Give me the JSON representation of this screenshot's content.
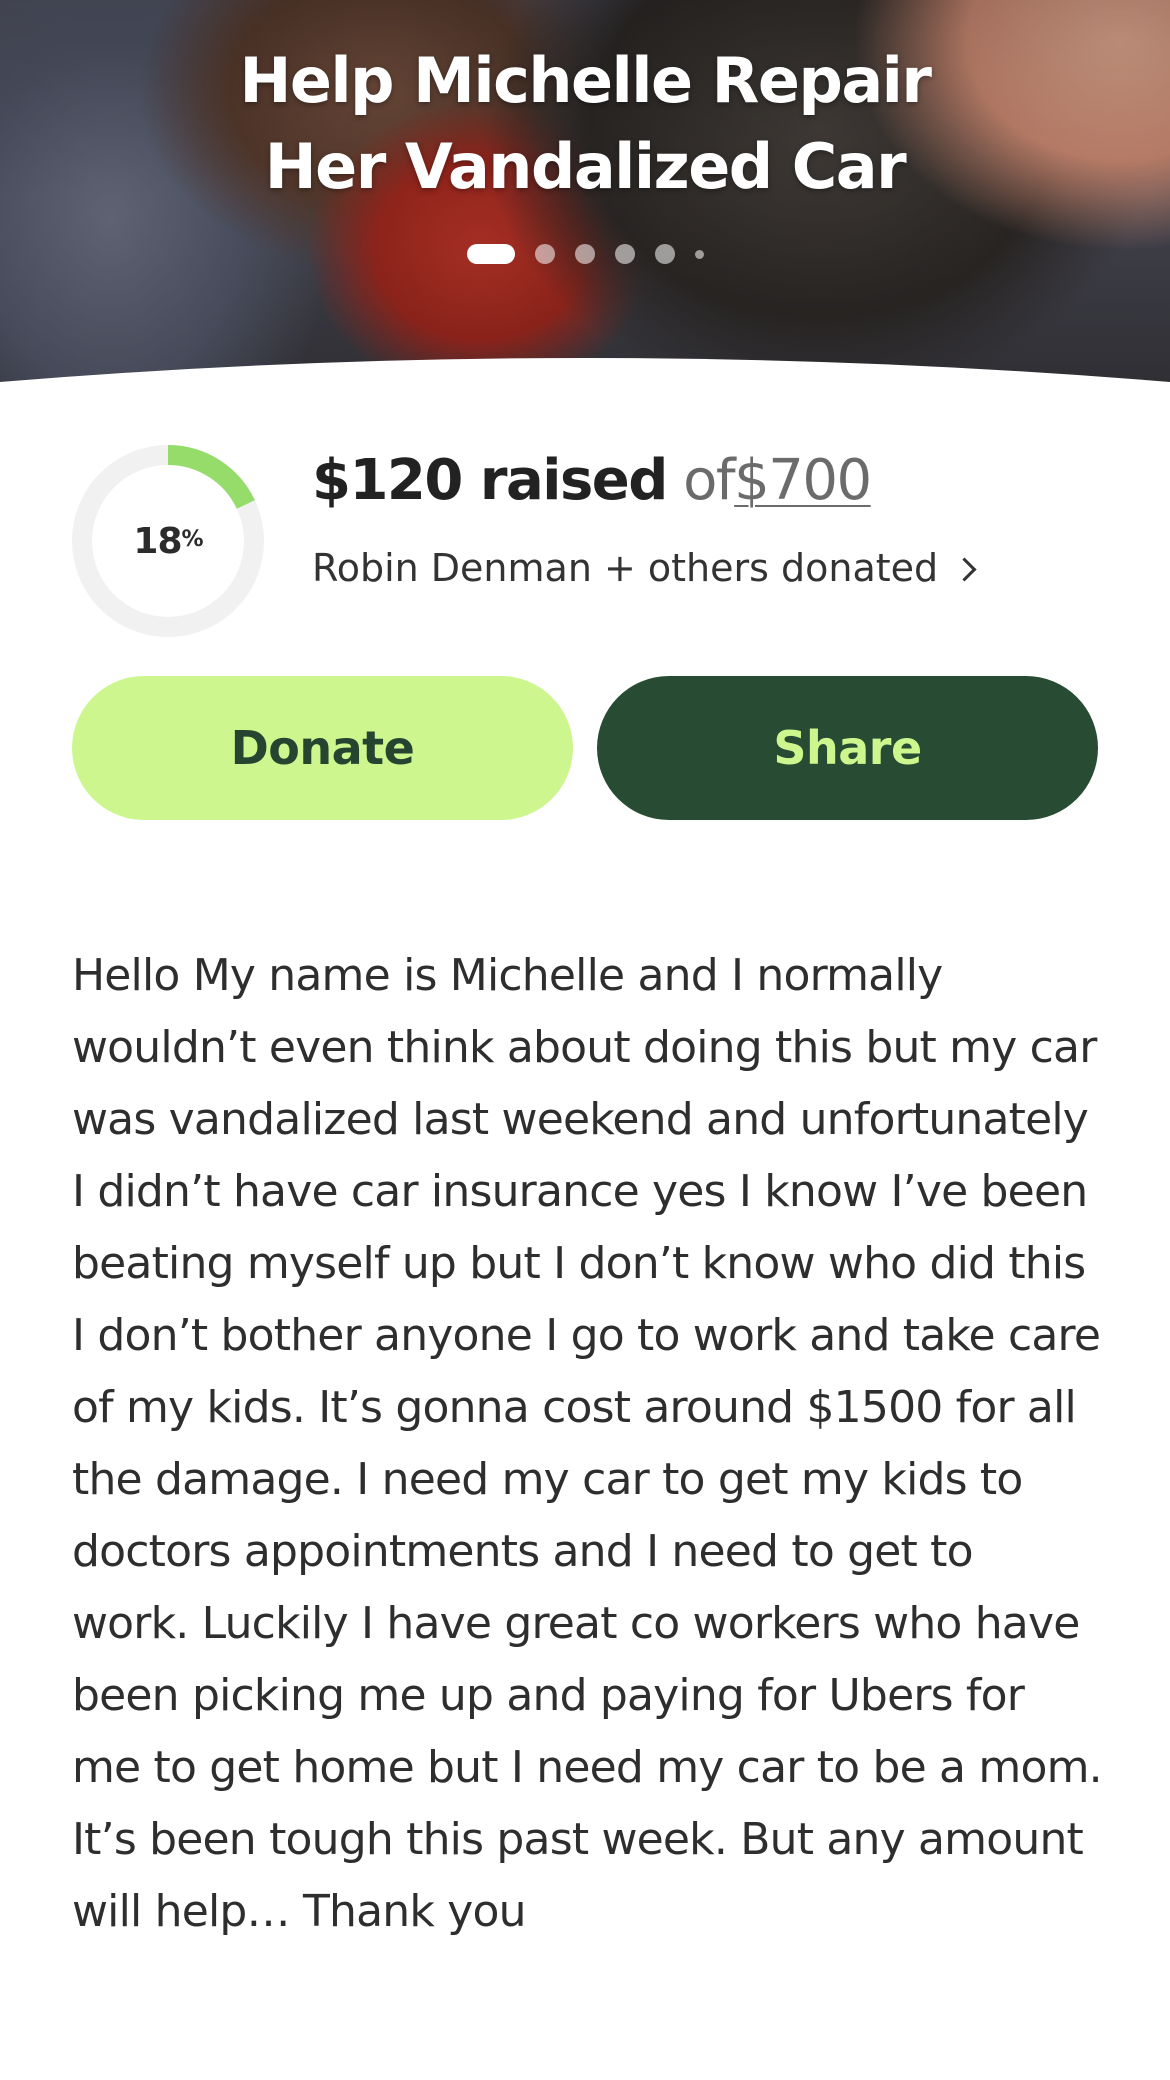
{
  "hero": {
    "title_line1": "Help Michelle Repair",
    "title_line2": "Her Vandalized Car",
    "carousel_total": 6,
    "carousel_active_index": 0
  },
  "progress": {
    "percent": 18,
    "percent_value": "18",
    "percent_suffix": "%",
    "raised_amount": "$120 raised",
    "of_text": "of",
    "goal": "$700",
    "donors_text": "Robin Denman + others donated"
  },
  "buttons": {
    "donate_label": "Donate",
    "share_label": "Share"
  },
  "story": {
    "text": "Hello My name is Michelle and I normally wouldn’t even think about doing this but my car was vandalized last weekend and unfortunately I didn’t have car insurance yes I know I’ve been beating myself up but I don’t know who did this I don’t bother anyone I go to work and take care of my kids. It’s gonna cost around $1500 for all the damage. I need my car to get my kids to doctors appointments and I need to get to work. Luckily I have great co workers who have been picking me up and paying for Ubers for me to get home but I need my car to be a mom. It’s been tough this past week. But any amount will help… Thank you"
  },
  "colors": {
    "donate_bg": "#cdf78e",
    "donate_text": "#254531",
    "share_bg": "#274b33",
    "share_text": "#cdf78e",
    "progress_fill": "#95dc6b",
    "progress_track": "#f1f1f1"
  }
}
